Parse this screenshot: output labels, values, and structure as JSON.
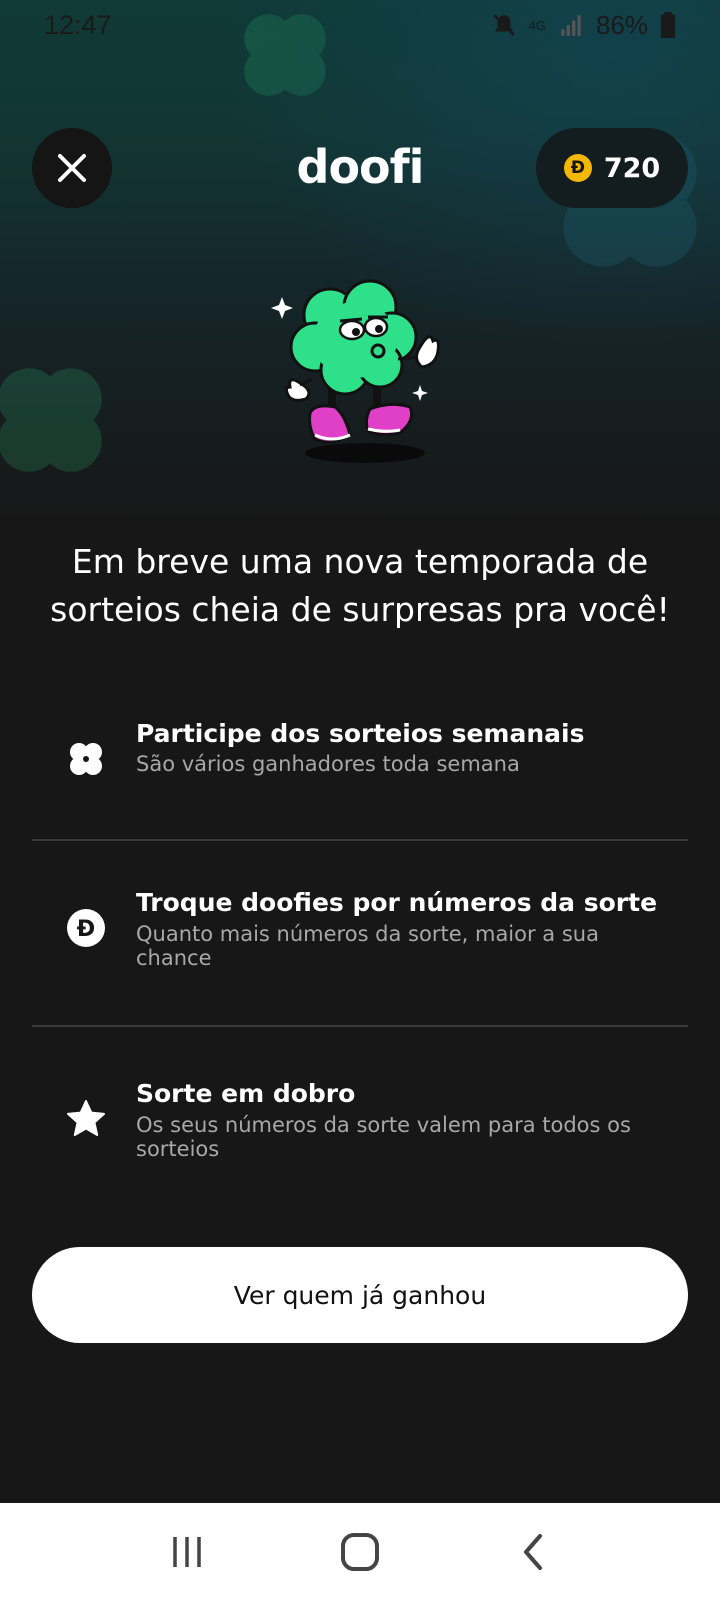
{
  "status_bar": {
    "time": "12:47",
    "network": "4G",
    "battery": "86%",
    "icons": [
      "mute-icon",
      "signal-icon",
      "battery-icon"
    ]
  },
  "header": {
    "close_icon": "close-icon",
    "logo": "doofi",
    "coin_symbol": "Đ",
    "coin_balance": "720"
  },
  "headline": "Em breve uma nova temporada de sorteios cheia de surpresas pra você!",
  "features": [
    {
      "icon": "clover-icon",
      "title": "Participe dos sorteios semanais",
      "description": "São vários ganhadores toda semana"
    },
    {
      "icon": "doofi-coin-icon",
      "title": "Troque doofies por números da sorte",
      "description": "Quanto mais números da sorte, maior a sua chance"
    },
    {
      "icon": "star-icon",
      "title": "Sorte em dobro",
      "description": "Os seus números da sorte valem para todos os sorteios"
    }
  ],
  "cta_label": "Ver quem já ganhou",
  "nav": [
    "recent-apps-icon",
    "home-icon",
    "back-icon"
  ],
  "colors": {
    "background": "#171717",
    "mascot_green": "#2fe08a",
    "coin": "#f5b800",
    "shoes": "#e040c8"
  }
}
